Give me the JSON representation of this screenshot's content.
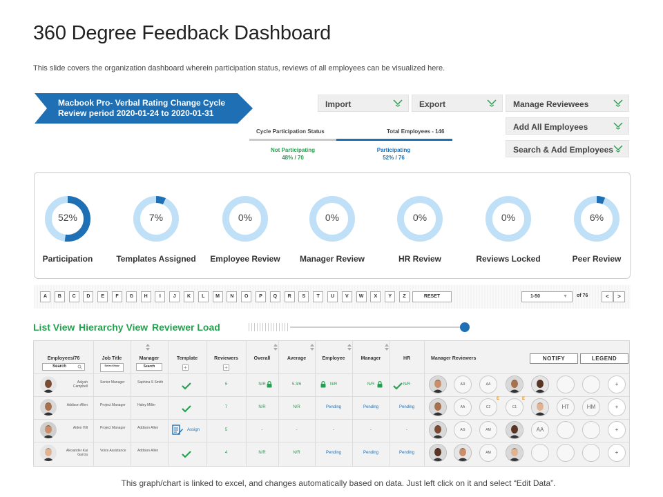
{
  "page": {
    "title": "360 Degree Feedback Dashboard",
    "subtitle": "This slide covers the organization dashboard wherein participation  status, reviews of all employees can be visualized here.",
    "footer": "This graph/chart is linked to excel, and changes automatically based on data. Just left click on it and select “Edit Data”."
  },
  "cycle": {
    "line1": "Macbook Pro- Verbal Rating Change Cycle",
    "line2": "Review period 2020-01-24 to 2020-01-31",
    "color": "#1f6fb5"
  },
  "actions": {
    "import": "Import",
    "export": "Export",
    "manage_reviewees": "Manage Reviewees",
    "add_all_employees": "Add All Employees",
    "search_add_employees": "Search & Add Employees",
    "chevron_icon": "chevron-down-icon"
  },
  "participation_status": {
    "label": "Cycle Participation Status",
    "total": "Total Employees - 146",
    "not_participating_label": "Not Participating",
    "not_participating_value": "48% / 70",
    "participating_label": "Participating",
    "participating_value": "52% / 76"
  },
  "donuts": [
    {
      "label": "Participation",
      "pct_text": "52%",
      "fraction": 0.52
    },
    {
      "label": "Templates Assigned",
      "pct_text": "7%",
      "fraction": 0.07
    },
    {
      "label": "Employee Review",
      "pct_text": "0%",
      "fraction": 0
    },
    {
      "label": "Manager Review",
      "pct_text": "0%",
      "fraction": 0
    },
    {
      "label": "HR Review",
      "pct_text": "0%",
      "fraction": 0
    },
    {
      "label": "Reviews Locked",
      "pct_text": "0%",
      "fraction": 0
    },
    {
      "label": "Peer Review",
      "pct_text": "6%",
      "fraction": 0.06
    }
  ],
  "donut_colors": {
    "track": "#bfe0f7",
    "fill": "#1f6fb5"
  },
  "alphabet": [
    "A",
    "B",
    "C",
    "D",
    "E",
    "F",
    "G",
    "H",
    "I",
    "J",
    "K",
    "L",
    "M",
    "N",
    "O",
    "P",
    "Q",
    "R",
    "S",
    "T",
    "U",
    "V",
    "W",
    "X",
    "Y",
    "Z"
  ],
  "pagination": {
    "reset": "RESET",
    "range": "1-50",
    "of_total": "of 76",
    "prev": "<",
    "next": ">"
  },
  "views": {
    "list": "List View",
    "hierarchy": "Hierarchy View",
    "reviewer_load": "Reviewer Load"
  },
  "table": {
    "headers": {
      "employees": "Employees/76",
      "employees_search": "Search",
      "job_title": "Job Title",
      "job_title_select": "Select Now",
      "manager": "Manager",
      "manager_search": "Search",
      "template": "Template",
      "reviewers": "Reviewers",
      "overall": "Overall",
      "average": "Average",
      "employee": "Employee",
      "manager_col": "Manager",
      "hr": "HR",
      "manager_reviewers": "Manager Reviewers",
      "notify": "NOTIFY",
      "legend": "LEGEND"
    },
    "rows": [
      {
        "name": "Aalyah Campbell",
        "job_title": "Senior Manager",
        "manager": "Saphina S Smith",
        "template": "check",
        "assign_label": "",
        "reviewers": "5",
        "overall": "N/R",
        "average": "5.3/6",
        "employee": "N/R",
        "manager_review": "N/R",
        "hr": "N/R",
        "reviewer_slots": [
          "photo",
          "AR",
          "AA",
          "photo",
          "photo",
          "",
          "",
          "+"
        ]
      },
      {
        "name": "Addison Allen",
        "job_title": "Project Manager",
        "manager": "Haley Miller",
        "template": "check",
        "assign_label": "",
        "reviewers": "7",
        "overall": "N/R",
        "average": "N/R",
        "employee": "Pending",
        "manager_review": "Pending",
        "hr": "Pending",
        "reviewer_slots": [
          "photo",
          "AA",
          "C2",
          "C1",
          "photo",
          "HT",
          "HM",
          "+"
        ]
      },
      {
        "name": "Aiden Hill",
        "job_title": "Project Manager",
        "manager": "Addison Allen",
        "template": "assign",
        "assign_label": "Assign",
        "reviewers": "5",
        "overall": "-",
        "average": "-",
        "employee": "-",
        "manager_review": "-",
        "hr": "-",
        "reviewer_slots": [
          "photo",
          "AG",
          "AM",
          "photo",
          "AA",
          "",
          "",
          "+"
        ]
      },
      {
        "name": "Alexander Kai Garcia",
        "job_title": "Voice Assistance",
        "manager": "Addison Allen",
        "template": "check",
        "assign_label": "",
        "reviewers": "4",
        "overall": "N/R",
        "average": "N/R",
        "employee": "Pending",
        "manager_review": "Pending",
        "hr": "Pending",
        "reviewer_slots": [
          "photo",
          "photo",
          "AM",
          "photo",
          "",
          "",
          "",
          "+"
        ]
      }
    ],
    "badge_letter": "E"
  }
}
